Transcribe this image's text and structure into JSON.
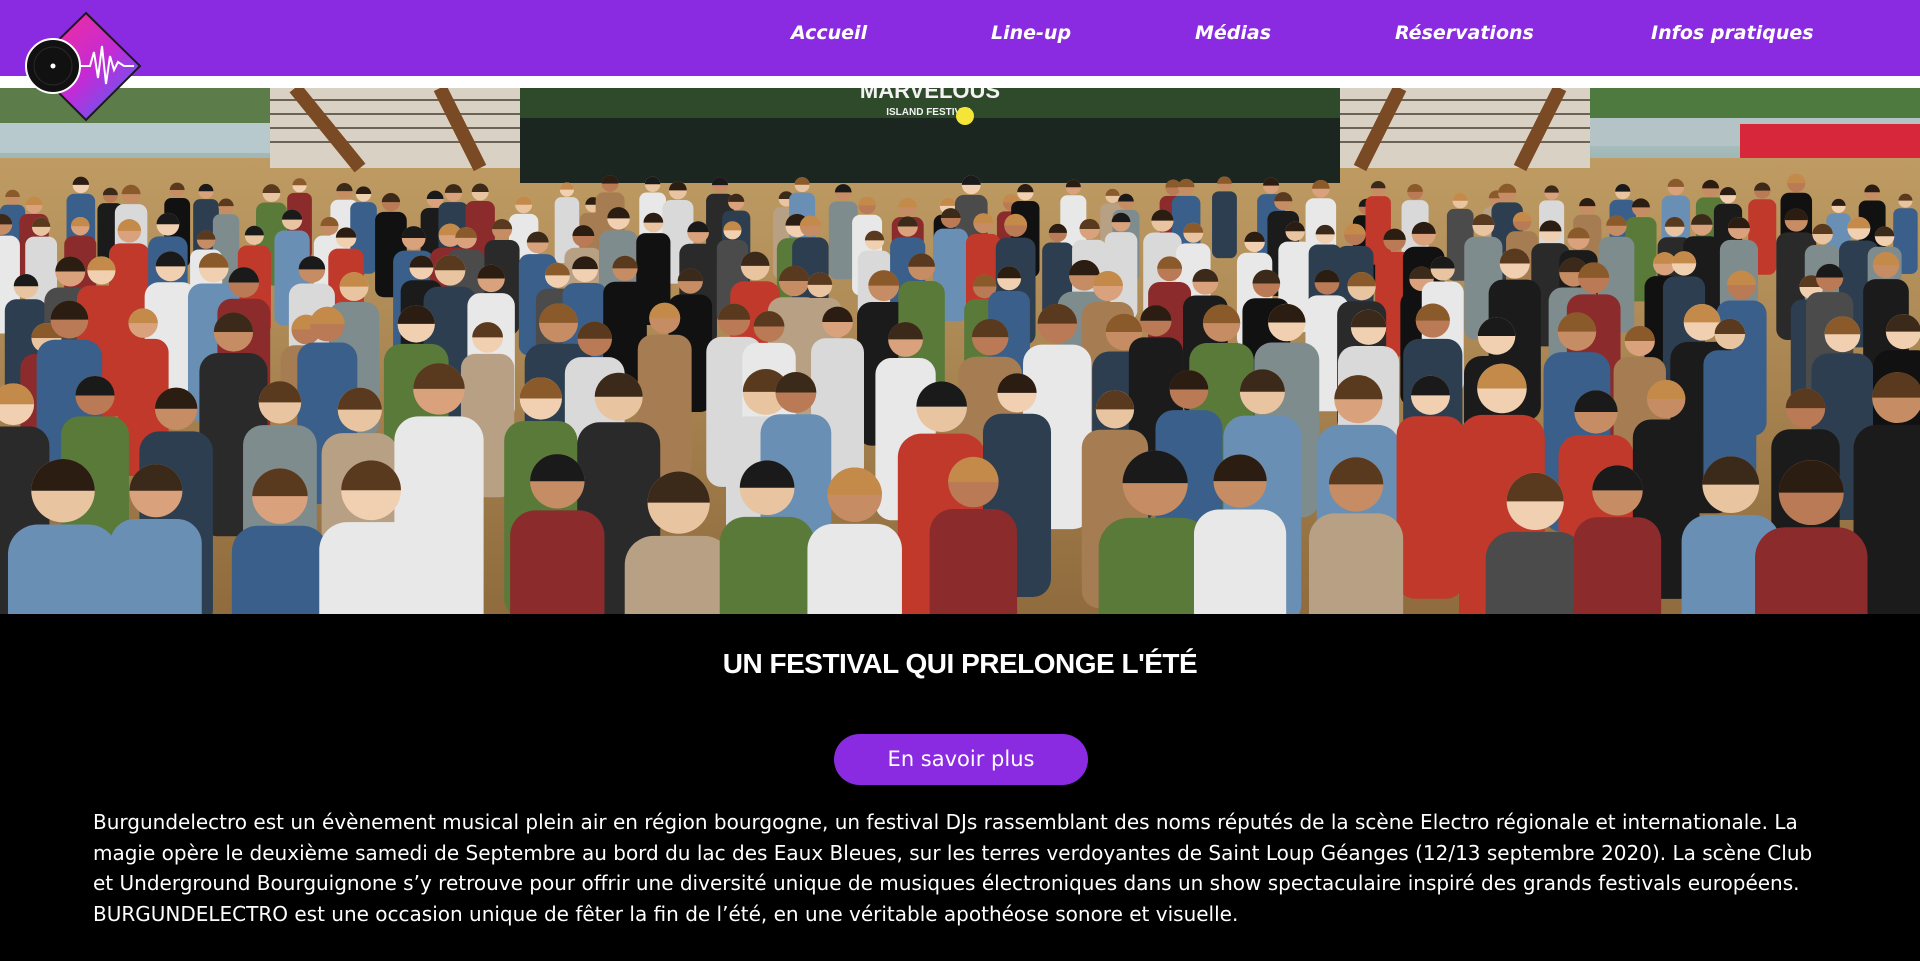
{
  "nav": {
    "items": [
      {
        "label": "Accueil"
      },
      {
        "label": "Line-up"
      },
      {
        "label": "Médias"
      },
      {
        "label": "Réservations"
      },
      {
        "label": "Infos pratiques"
      }
    ]
  },
  "hero": {
    "stage_sign": "MARVELOUS",
    "stage_subsign": "ISLAND FESTIVAL"
  },
  "main": {
    "heading": "UN FESTIVAL QUI PRELONGE L'ÉTÉ",
    "cta_label": "En savoir plus",
    "description": "Burgundelectro est un évènement musical plein air en région bourgogne, un festival DJs rassemblant des noms réputés de la scène Electro régionale et internationale. La magie opère le deuxième samedi de Septembre au bord du lac des Eaux Bleues, sur les terres verdoyantes de Saint Loup Géanges (12/13 septembre 2020). La scène Club et Underground Bourguignone s’y retrouve pour offrir une diversité unique de musiques électroniques dans un show spectaculaire inspiré des grands festivals européens. BURGUNDELECTRO est une occasion unique de fêter la fin de l’été, en une véritable apothéose sonore et visuelle."
  },
  "colors": {
    "nav_bg": "#8a2be2",
    "button_bg": "#8a2be2",
    "page_bg": "#000000",
    "text": "#ffffff"
  },
  "icons": {
    "logo": "vinyl-record-waveform-logo"
  }
}
